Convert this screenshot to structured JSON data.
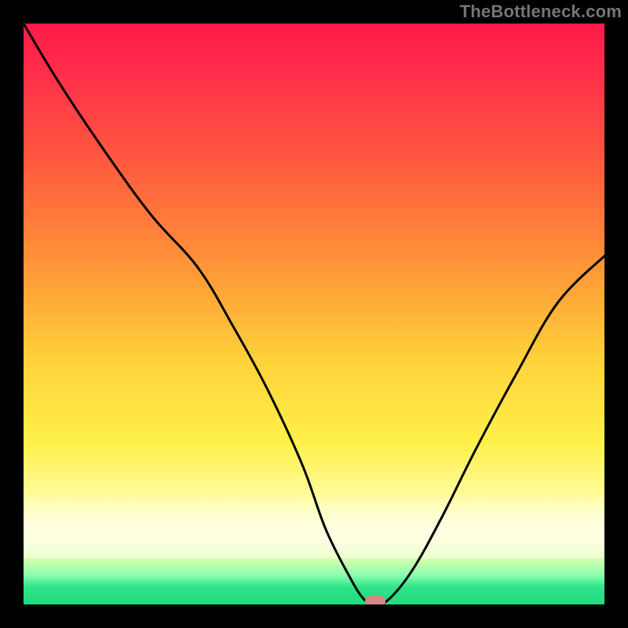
{
  "watermark": "TheBottleneck.com",
  "chart_data": {
    "type": "line",
    "title": "",
    "xlabel": "",
    "ylabel": "",
    "xlim": [
      0,
      100
    ],
    "ylim": [
      0,
      100
    ],
    "grid": false,
    "series": [
      {
        "name": "bottleneck-curve",
        "x": [
          0,
          6,
          14,
          22,
          30,
          36,
          42,
          48,
          52,
          56,
          58.5,
          60.5,
          63,
          67,
          72,
          78,
          85,
          92,
          100
        ],
        "y": [
          100,
          90,
          78,
          67,
          58,
          48,
          37,
          24,
          13,
          5,
          1,
          0,
          1,
          6,
          15,
          27,
          40,
          52,
          60
        ]
      }
    ],
    "annotations": [
      {
        "name": "min-marker",
        "x": 60.5,
        "y": 0.5
      }
    ],
    "background": {
      "type": "vertical-gradient",
      "stops": [
        {
          "pos": 0.0,
          "color": "#ff1a4a"
        },
        {
          "pos": 0.4,
          "color": "#ff8f38"
        },
        {
          "pos": 0.72,
          "color": "#fff04a"
        },
        {
          "pos": 0.88,
          "color": "#fcffd0"
        },
        {
          "pos": 1.0,
          "color": "#1edc7e"
        }
      ]
    }
  }
}
